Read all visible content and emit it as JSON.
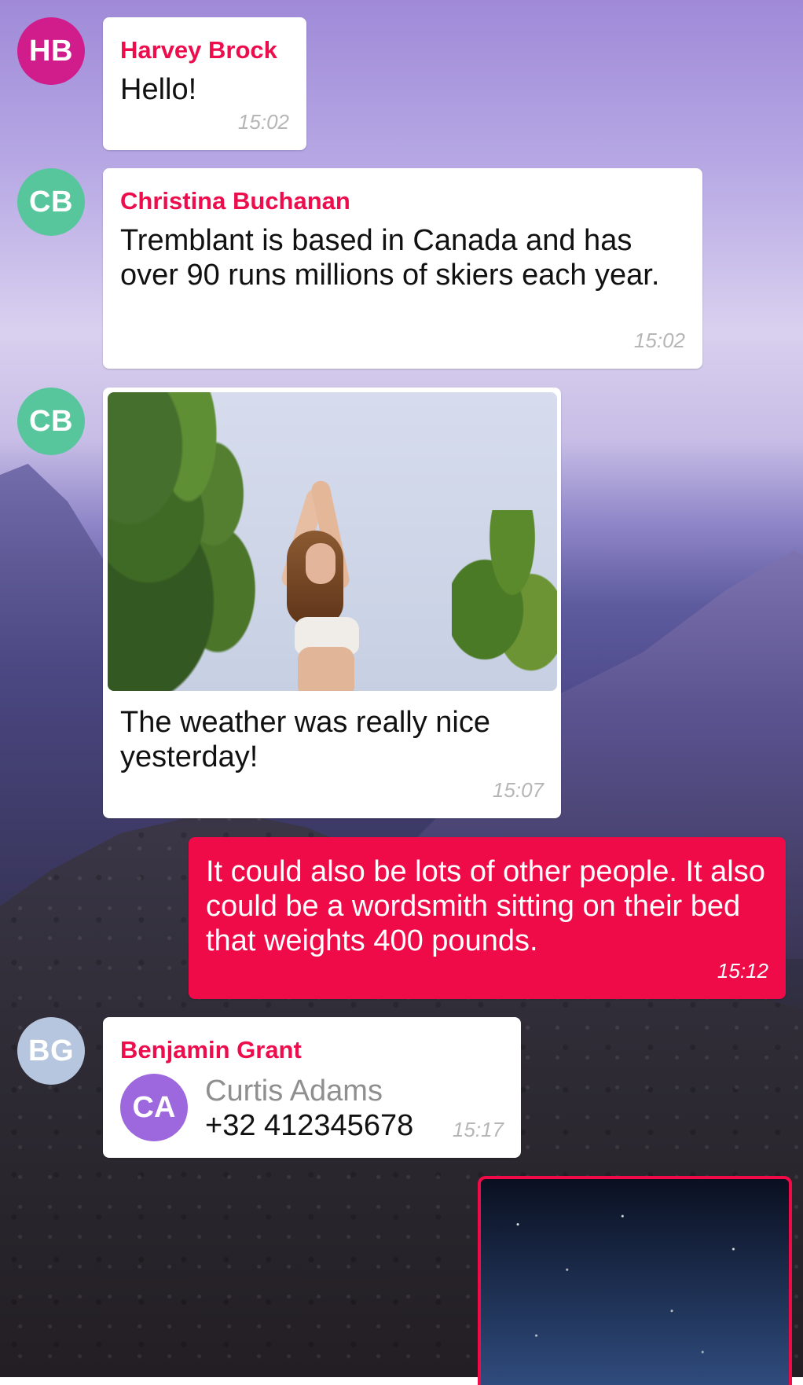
{
  "messages": [
    {
      "avatar": "HB",
      "avatar_color": "#d11d8c",
      "sender": "Harvey Brock",
      "text": "Hello!",
      "time": "15:02"
    },
    {
      "avatar": "CB",
      "avatar_color": "#58c69d",
      "sender": "Christina Buchanan",
      "text": "Tremblant is based in Canada and has over 90 runs millions of skiers each year.",
      "time": "15:02"
    },
    {
      "avatar": "CB",
      "avatar_color": "#58c69d",
      "text": "The weather was really nice yesterday!",
      "time": "15:07"
    },
    {
      "text": "It could also be lots of other people. It also could be a wordsmith sitting on their bed that weights 400 pounds.",
      "time": "15:12"
    },
    {
      "avatar": "BG",
      "avatar_color": "#b6c6de",
      "sender": "Benjamin Grant",
      "contact_initials": "CA",
      "contact_name": "Curtis Adams",
      "contact_phone": "+32 412345678",
      "time": "15:17"
    }
  ],
  "colors": {
    "accent": "#ef0b48",
    "contact_avatar": "#9d67de"
  }
}
